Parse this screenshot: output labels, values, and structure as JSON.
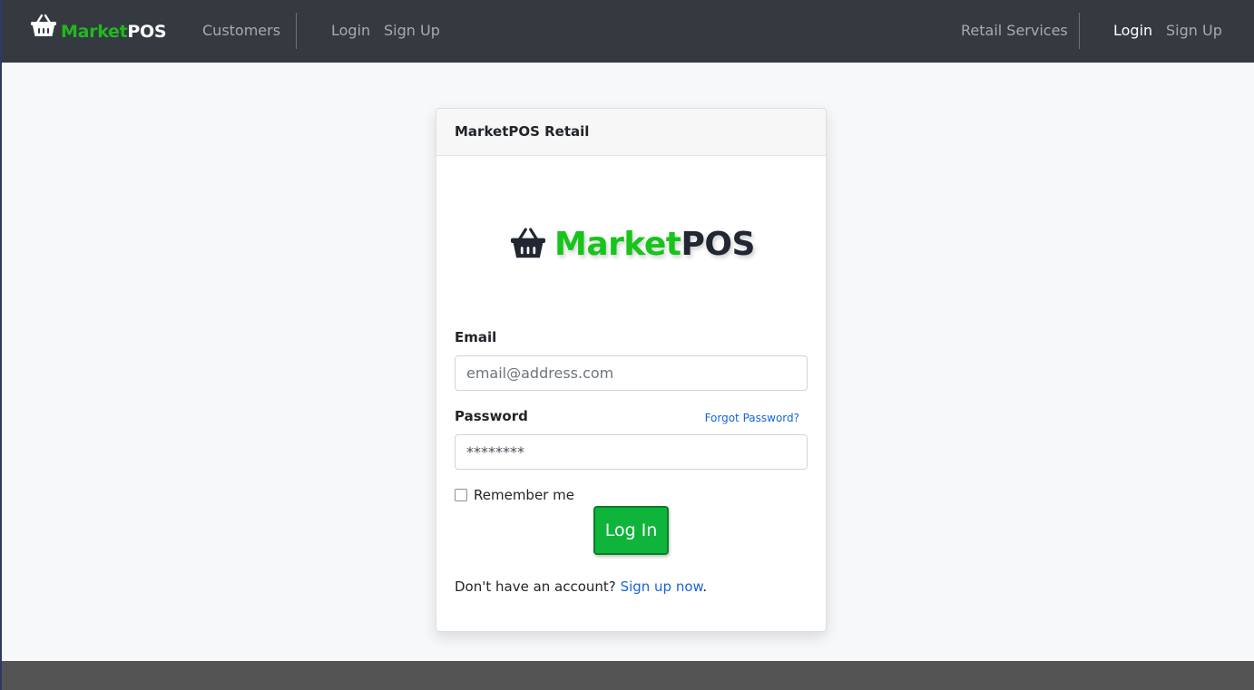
{
  "navbar": {
    "brand": {
      "part1": "Market",
      "part2": "POS",
      "icon": "basket-icon"
    },
    "left_links": [
      {
        "label": "Customers"
      },
      {
        "label": "Login"
      },
      {
        "label": "Sign Up"
      }
    ],
    "right_links": [
      {
        "label": "Retail Services"
      },
      {
        "label": "Login"
      },
      {
        "label": "Sign Up"
      }
    ]
  },
  "card": {
    "header": "MarketPOS Retail",
    "logo": {
      "part1": "Market",
      "part2": "POS",
      "icon": "basket-icon"
    },
    "email": {
      "label": "Email",
      "placeholder": "email@address.com",
      "value": ""
    },
    "password": {
      "label": "Password",
      "value": "********",
      "forgot_link": "Forgot Password?"
    },
    "remember": {
      "label": "Remember me",
      "checked": false
    },
    "login_button": "Log In",
    "signup": {
      "prompt": "Don't have an account?",
      "link": "Sign up now",
      "suffix": "."
    }
  },
  "colors": {
    "navbar_bg": "#343a40",
    "brand_green": "#22b820",
    "button_green": "#0fb53a",
    "link_blue": "#1565d8",
    "footer_bg": "#545454"
  }
}
